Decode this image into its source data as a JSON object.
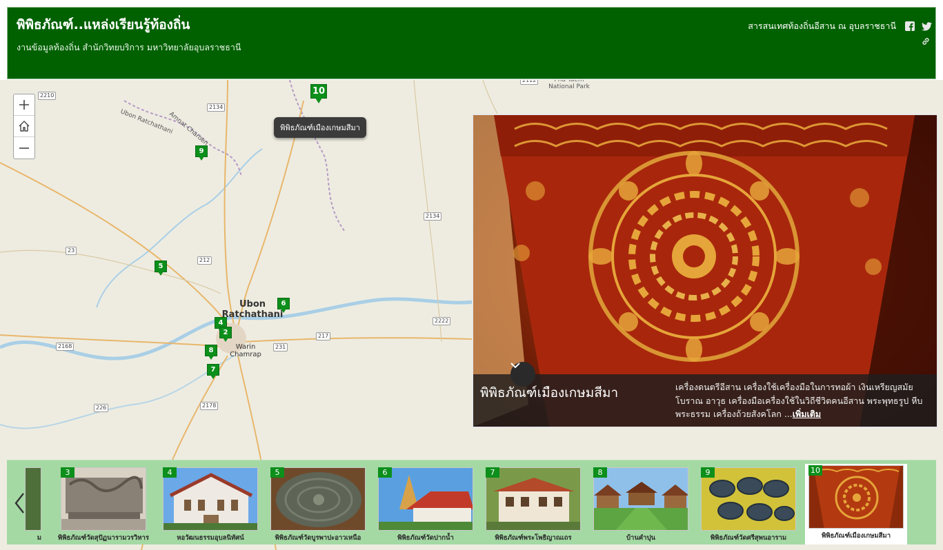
{
  "header": {
    "title": "พิพิธภัณฑ์..แหล่งเรียนรู้ท้องถิ่น",
    "subtitle": "งานข้อมูลท้องถิ่น สำนักวิทยบริการ มหาวิทยาลัยอุบลราชธานี",
    "link_text": "สารสนเทศท้องถิ่นอีสาน ณ อุบลราชธานี",
    "icons": [
      "facebook-icon",
      "twitter-icon",
      "share-link-icon"
    ]
  },
  "map": {
    "zoom_in": "+",
    "zoom_out": "−",
    "tooltip": "พิพิธภัณฑ์เมืองเกษมสีมา",
    "city_main": [
      "Ubon",
      "Ratchathani"
    ],
    "city_small": [
      "Warin",
      "Chamrap"
    ],
    "place_labels": [
      "Pha Taem National Park",
      "Ubon Ratchathani",
      "Amnat Charoen"
    ],
    "road_numbers": [
      "2210",
      "2134",
      "23",
      "212",
      "2134",
      "2222",
      "217",
      "2168",
      "231",
      "226",
      "2178",
      "2112"
    ],
    "markers": [
      "10",
      "9",
      "5",
      "6",
      "4",
      "2",
      "8",
      "7"
    ]
  },
  "panel": {
    "title": "พิพิธภัณฑ์เมืองเกษมสีมา",
    "description": "เครื่องดนตรีอีสาน เครื่องใช้เครื่องมือในการทอผ้า เงินเหรียญสมัยโบราณ อาวุธ เครื่องมือเครื่องใช้ในวิถีชีวิตคนอีสาน พระพุทธรูป หีบพระธรรม เครื่องถ้วยสังคโลก ...",
    "more": "เพิ่มเติม",
    "colors": {
      "caption_bg": "#1e1e1e",
      "artifact_red": "#a8270c",
      "gold": "#e6a53a"
    }
  },
  "carousel": {
    "partial_label": "ม",
    "items": [
      {
        "num": "3",
        "label": "พิพิธภัณฑ์วัดสุปัฏนารามวรวิหาร"
      },
      {
        "num": "4",
        "label": "หอวัฒนธรรมอุบลนิทัศน์"
      },
      {
        "num": "5",
        "label": "พิพิธภัณฑ์วัดบูรพาปะอาวเหนือ"
      },
      {
        "num": "6",
        "label": "พิพิธภัณฑ์วัดปากน้ำ"
      },
      {
        "num": "7",
        "label": "พิพิธภัณฑ์พระโพธิญาณเถร"
      },
      {
        "num": "8",
        "label": "บ้านคำปุน"
      },
      {
        "num": "9",
        "label": "พิพิธภัณฑ์วัดศรีสุพนอาราม"
      },
      {
        "num": "10",
        "label": "พิพิธภัณฑ์เมืองเกษมสีมา"
      }
    ]
  },
  "brand_color": "#016101"
}
